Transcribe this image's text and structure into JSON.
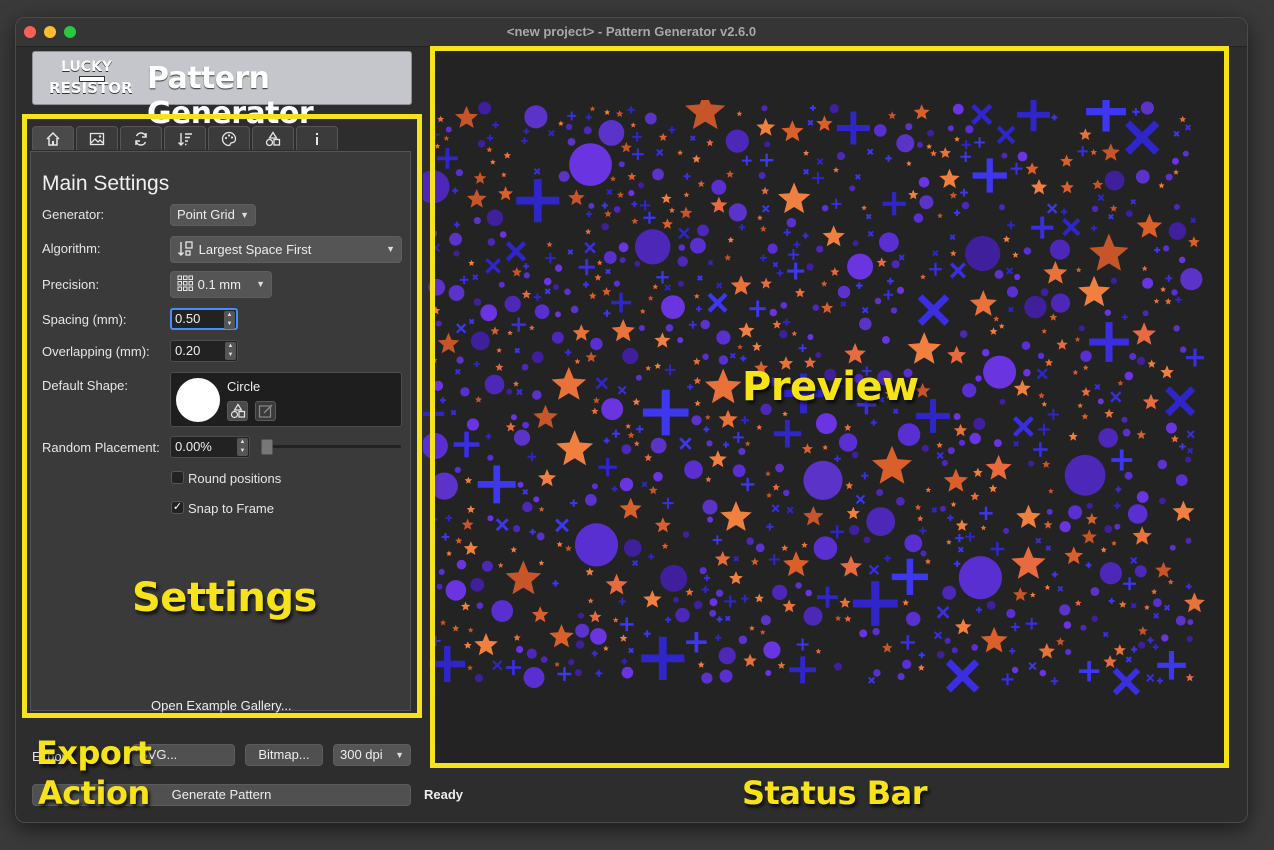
{
  "window": {
    "title": "<new project> - Pattern Generator v2.6.0"
  },
  "logo": {
    "brand_line1": "LUCKY",
    "brand_line2": "RESISTOR",
    "product": "Pattern Generator"
  },
  "tabs": [
    {
      "icon": "home-icon"
    },
    {
      "icon": "image-icon"
    },
    {
      "icon": "refresh-icon"
    },
    {
      "icon": "sort-icon"
    },
    {
      "icon": "palette-icon"
    },
    {
      "icon": "shapes-icon"
    },
    {
      "icon": "info-icon"
    }
  ],
  "settings": {
    "section_title": "Main Settings",
    "generator": {
      "label": "Generator:",
      "value": "Point Grid"
    },
    "algorithm": {
      "label": "Algorithm:",
      "value": "Largest Space First"
    },
    "precision": {
      "label": "Precision:",
      "value": "0.1 mm"
    },
    "spacing": {
      "label": "Spacing (mm):",
      "value": "0.50"
    },
    "overlapping": {
      "label": "Overlapping (mm):",
      "value": "0.20"
    },
    "default_shape": {
      "label": "Default Shape:",
      "value": "Circle"
    },
    "random_placement": {
      "label": "Random Placement:",
      "value": "0.00%",
      "slider_fraction": 0
    },
    "round_positions": {
      "label": "Round positions",
      "checked": false
    },
    "snap_to_frame": {
      "label": "Snap to Frame",
      "checked": true
    },
    "gallery_link": "Open Example Gallery..."
  },
  "export": {
    "label": "Export:",
    "svg_button": "SVG...",
    "bitmap_button": "Bitmap...",
    "dpi": "300 dpi"
  },
  "action": {
    "generate_button": "Generate Pattern"
  },
  "status": {
    "text": "Ready"
  },
  "annotations": {
    "settings": "Settings",
    "preview": "Preview",
    "export": "Export",
    "action": "Action",
    "status_bar": "Status Bar"
  },
  "colors": {
    "annotation": "#f7e319",
    "purple": "#5a2fd1",
    "blue": "#3a2ee0",
    "orange": "#e8723a",
    "background": "#232323"
  }
}
